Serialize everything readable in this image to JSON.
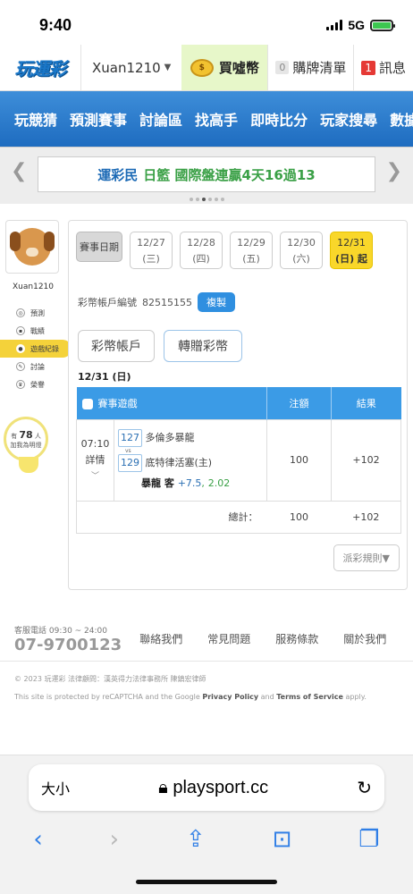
{
  "status": {
    "time": "9:40",
    "network": "5G"
  },
  "topbar": {
    "logo": "玩運彩",
    "username": "Xuan1210",
    "buy_coin": "買噓幣",
    "cart_count": "0",
    "cart_label": "購牌清單",
    "msg_count": "1",
    "msg_label": "訊息"
  },
  "menu": [
    "玩競猜",
    "預測賽事",
    "討論區",
    "找高手",
    "即時比分",
    "玩家搜尋",
    "數據"
  ],
  "banner": {
    "part1": "運彩民",
    "part2": "日籃 國際盤連贏4天16過13"
  },
  "sidebar": {
    "username": "Xuan1210",
    "items": [
      "預測",
      "戰績",
      "遊戲紀錄",
      "討論",
      "榮譽"
    ],
    "fans_prefix": "有",
    "fans_count": "78",
    "fans_unit": "人",
    "fans_suffix": "加我為明燈"
  },
  "dates": {
    "label": "賽事日期",
    "items": [
      {
        "date": "12/27",
        "day": "(三)"
      },
      {
        "date": "12/28",
        "day": "(四)"
      },
      {
        "date": "12/29",
        "day": "(五)"
      },
      {
        "date": "12/30",
        "day": "(六)"
      },
      {
        "date": "12/31",
        "day": "(日) 起"
      }
    ]
  },
  "account": {
    "label": "彩幣帳戶編號",
    "number": "82515155",
    "copy": "複製"
  },
  "tabs": [
    "彩幣帳戶",
    "轉贈彩幣"
  ],
  "section_date": "12/31 (日)",
  "table": {
    "headers": [
      "賽事遊戲",
      "注額",
      "結果"
    ],
    "row": {
      "time": "07:10",
      "detail": "詳情",
      "team1_num": "127",
      "team1": "多倫多暴龍",
      "vs": "vs",
      "team2_num": "129",
      "team2": "底特律活塞(主)",
      "pick_team": "暴龍 客",
      "pick_spread": "+7.5",
      "pick_odds": "2.02",
      "stake": "100",
      "result": "+102"
    },
    "total_label": "總計：",
    "total_stake": "100",
    "total_result": "+102"
  },
  "rules_button": "派彩規則▼",
  "footer": {
    "phone_label": "客服電話 09:30 ~ 24:00",
    "phone": "07-9700123",
    "links": [
      "聯絡我們",
      "常見問題",
      "服務條款",
      "關於我們"
    ],
    "copyright": "© 2023 玩運彩 法律顧問：漢英得力法律事務所 陳鎮宏律師",
    "recaptcha_pre": "This site is protected by reCAPTCHA and the Google",
    "privacy": "Privacy Policy",
    "and": "and",
    "terms": "Terms of Service",
    "apply": "apply."
  },
  "browser": {
    "text_size": "大小",
    "url": "playsport.cc"
  },
  "colors": {
    "accent_blue": "#2f8fe0",
    "yellow": "#f9d72a",
    "green": "#3aa046"
  }
}
